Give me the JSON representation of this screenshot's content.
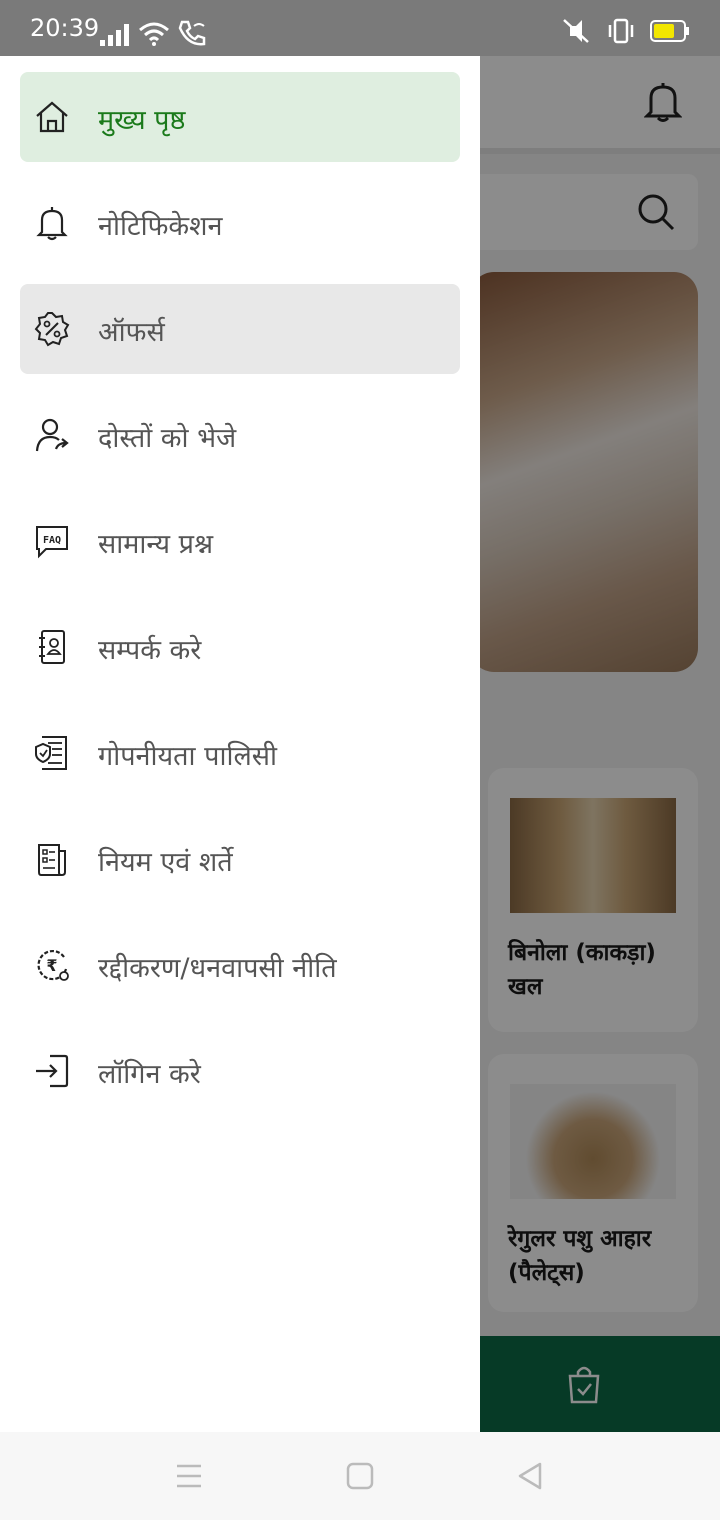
{
  "status": {
    "time": "20:39"
  },
  "drawer": {
    "items": [
      {
        "label": "मुख्य पृष्ठ",
        "icon": "home-icon"
      },
      {
        "label": "नोटिफिकेशन",
        "icon": "bell-icon"
      },
      {
        "label": "ऑफर्स",
        "icon": "discount-badge-icon"
      },
      {
        "label": "दोस्तों को भेजे",
        "icon": "share-user-icon"
      },
      {
        "label": "सामान्य प्रश्न",
        "icon": "faq-icon"
      },
      {
        "label": "सम्पर्क करे",
        "icon": "contact-book-icon"
      },
      {
        "label": "गोपनीयता पालिसी",
        "icon": "privacy-policy-icon"
      },
      {
        "label": "नियम एवं शर्ते",
        "icon": "terms-document-icon"
      },
      {
        "label": "रद्दीकरण/धनवापसी नीति",
        "icon": "refund-rupee-icon"
      },
      {
        "label": "लॉगिन करे",
        "icon": "login-icon"
      }
    ],
    "faq_icon_text": "FAQ"
  },
  "background": {
    "products": [
      {
        "name": "बिनोला (काकड़ा) खल"
      },
      {
        "name": "रेगुलर पशु आहार (पैलेट्स)"
      }
    ]
  },
  "colors": {
    "active_bg": "#dfeee0",
    "active_text": "#1b7a1b",
    "bottom_bar": "#0b6b45"
  }
}
